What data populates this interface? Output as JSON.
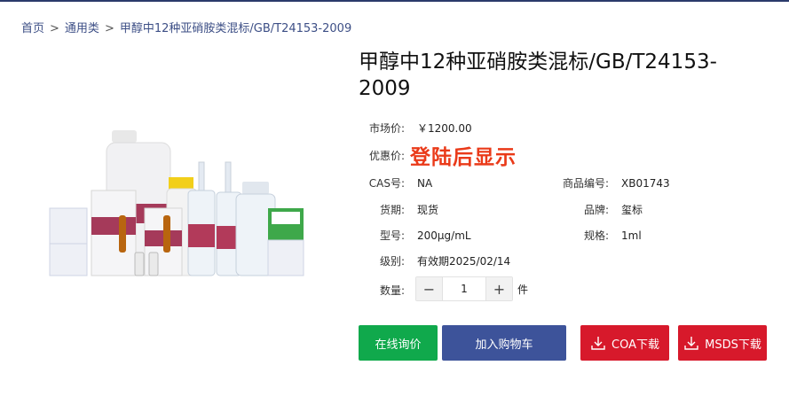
{
  "breadcrumb": {
    "home": "首页",
    "separator": ">",
    "category": "通用类",
    "current": "甲醇中12种亚硝胺类混标/GB/T24153-2009"
  },
  "product": {
    "title": "甲醇中12种亚硝胺类混标/GB/T24153-2009",
    "market_price_label": "市场价:",
    "market_price": "￥1200.00",
    "promo_label": "优惠价:",
    "promo_text": "登陆后显示",
    "cas_label": "CAS号:",
    "cas": "NA",
    "sku_label": "商品编号:",
    "sku": "XB01743",
    "stock_label": "货期:",
    "stock": "现货",
    "brand_label": "品牌:",
    "brand": "玺标",
    "model_label": "型号:",
    "model": "200μg/mL",
    "spec_label": "规格:",
    "spec": "1ml",
    "grade_label": "级别:",
    "grade": "有效期2025/02/14"
  },
  "quantity": {
    "label": "数量:",
    "minus": "−",
    "value": "1",
    "plus": "+",
    "unit": "件"
  },
  "actions": {
    "inquiry": "在线询价",
    "add_to_cart": "加入购物车",
    "coa_download": "COA下载",
    "msds_download": "MSDS下载"
  },
  "colors": {
    "header_line": "#2b3a6b",
    "promo": "#ea3a19",
    "inquiry_button": "#10a94c",
    "cart_button": "#3d539a",
    "download_button": "#d7192b"
  },
  "icons": {
    "download": "download-icon"
  }
}
